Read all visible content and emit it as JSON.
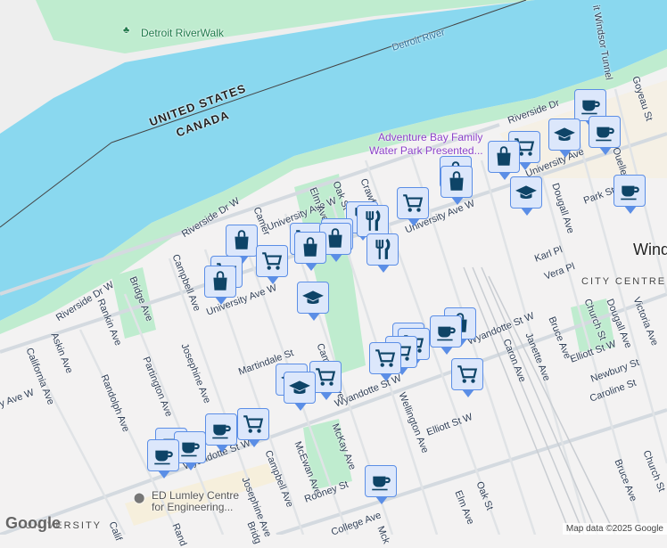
{
  "map": {
    "water_color": "#8ad8ef",
    "land_color": "#f3f2f2",
    "park_color": "#bfeccf",
    "marker_color": "#0e4467",
    "labels": {
      "riverwalk": "Detroit RiverWalk",
      "river": "Detroit River",
      "us": "UNITED STATES",
      "canada": "CANADA",
      "riverside_dr": "Riverside Dr",
      "riverside_dr_w": "Riverside Dr W",
      "riverside_dr_w2": "Riverside Dr W",
      "adventure_bay": "Adventure Bay Family",
      "adventure_bay2": "Water Park Presented...",
      "tunnel": "it Windsor Tunnel",
      "goyeau": "Goyeau St",
      "ouellette": "Ouellette Ave",
      "dougall": "Dougall Ave",
      "park_st": "Park St",
      "university_ave_w": "University Ave W",
      "university_ave_w2": "University Ave W",
      "university_ave_w3": "University Ave W",
      "university_ave": "University Ave",
      "campbell": "Campbell Ave",
      "campbell2": "Campbell Ave",
      "bridge": "Bridge Ave",
      "bridge2": "Bridg",
      "rankin": "Rankin Ave",
      "askin": "Askin Ave",
      "california": "California Ave",
      "california2": "Calif",
      "randolph": "Randolph Ave",
      "randolph2": "Rand",
      "partington": "Partington Ave",
      "josephine": "Josephine Ave",
      "josephine2": "Josephine Ave",
      "martindale": "Martindale St",
      "cameron": "Cameron Ave",
      "cameron2": "Camer",
      "mcewan": "McEwan Ave",
      "mckay": "McKay Ave",
      "mck2": "Mck",
      "rooney": "Rooney St",
      "college": "College Ave",
      "wyandotte": "Wyandotte St W",
      "wyandotte2": "Wyandotte St W",
      "wyandotte3": "Wyandotte St W",
      "wellington": "Wellington Ave",
      "elliott": "Elliott St W",
      "elliott2": "Elliott St W",
      "crawford": "Crawford Ave",
      "elm": "Elm Ave",
      "elm2": "Elm Ave",
      "oak": "Oak St",
      "oak2": "Oak St",
      "caron": "Caron Ave",
      "janette": "Janette Ave",
      "bruce": "Bruce Ave",
      "bruce2": "Bruce Ave",
      "church": "Church St",
      "church2": "Church St",
      "dougall2": "Dougall Ave",
      "victoria": "Victoria Ave",
      "newbury": "Newbury St",
      "caroline": "Caroline St",
      "karl": "Karl Pl",
      "vera": "Vera Pl",
      "city_centre": "CITY CENTRE",
      "windsor": "Wind",
      "ed_lumley": "ED Lumley Centre",
      "ed_lumley2": "for Engineering...",
      "university": "UNIVERSITY",
      "ave_w": "y Ave W"
    },
    "google_logo": "Google",
    "attribution": "Map data ©2025 Google"
  }
}
